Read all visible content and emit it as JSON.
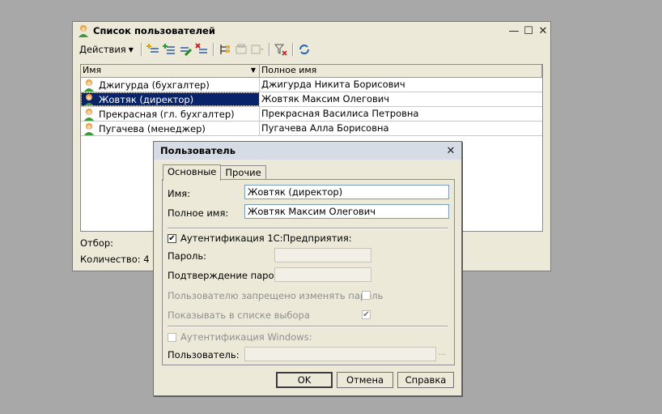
{
  "users_window": {
    "title": "Список пользователей",
    "toolbar": {
      "actions_label": "Действия"
    },
    "columns": [
      "Имя",
      "Полное имя"
    ],
    "rows": [
      {
        "name": "Джигурда (бухгалтер)",
        "full_name": "Джигурда Никита Борисович"
      },
      {
        "name": "Жовтяк (директор)",
        "full_name": "Жовтяк Максим Олегович"
      },
      {
        "name": "Прекрасная (гл. бухгалтер)",
        "full_name": "Прекрасная Василиса Петровна"
      },
      {
        "name": "Пугачева (менеджер)",
        "full_name": "Пугачева Алла Борисовна"
      }
    ],
    "selected_row": 1,
    "filter_label": "Отбор:",
    "count_label": "Количество: 4"
  },
  "user_dialog": {
    "title": "Пользователь",
    "tabs": [
      "Основные",
      "Прочие"
    ],
    "name_label": "Имя:",
    "name_value": "Жовтяк (директор)",
    "full_name_label": "Полное имя:",
    "full_name_value": "Жовтяк Максим Олегович",
    "auth_1c_label": "Аутентификация 1С:Предприятия:",
    "auth_1c_checked": true,
    "password_label": "Пароль:",
    "password_confirm_label": "Подтверждение пароля:",
    "forbid_change_label": "Пользователю запрещено изменять пароль",
    "forbid_change_checked": false,
    "show_in_list_label": "Показывать в списке выбора",
    "show_in_list_checked": true,
    "auth_windows_label": "Аутентификация Windows:",
    "auth_windows_checked": false,
    "os_user_label": "Пользователь:",
    "ellipsis": "...",
    "buttons": {
      "ok": "OK",
      "cancel": "Отмена",
      "help": "Справка"
    }
  },
  "icons": {
    "user": "user-icon",
    "minimize": "minimize-icon",
    "maximize": "maximize-icon",
    "close": "close-icon"
  }
}
